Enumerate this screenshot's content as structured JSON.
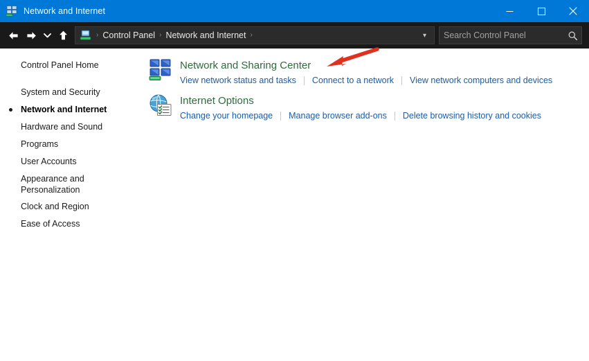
{
  "window": {
    "title": "Network and Internet",
    "title_icon": "network-icon",
    "controls": {
      "minimize": "minimize-button",
      "maximize": "maximize-button",
      "close": "close-button"
    }
  },
  "navbar": {
    "back": "back-arrow-icon",
    "forward": "forward-arrow-icon",
    "recent": "chevron-down-icon",
    "up": "up-arrow-icon",
    "breadcrumb": {
      "icon": "control-panel-network-icon",
      "items": [
        "Control Panel",
        "Network and Internet"
      ],
      "separator": "›",
      "trailing_separator": "›"
    },
    "address_dropdown": "chevron-down-icon"
  },
  "search": {
    "placeholder": "Search Control Panel",
    "value": "",
    "icon": "search-icon"
  },
  "sidebar": {
    "items": [
      {
        "label": "Control Panel Home",
        "selected": false,
        "home": true
      },
      {
        "label": "System and Security",
        "selected": false
      },
      {
        "label": "Network and Internet",
        "selected": true
      },
      {
        "label": "Hardware and Sound",
        "selected": false
      },
      {
        "label": "Programs",
        "selected": false
      },
      {
        "label": "User Accounts",
        "selected": false
      },
      {
        "label": "Appearance and Personalization",
        "selected": false,
        "wrap": true
      },
      {
        "label": "Clock and Region",
        "selected": false
      },
      {
        "label": "Ease of Access",
        "selected": false
      }
    ]
  },
  "main": {
    "categories": [
      {
        "icon": "network-sharing-center-icon",
        "title": "Network and Sharing Center",
        "links": [
          "View network status and tasks",
          "Connect to a network",
          "View network computers and devices"
        ]
      },
      {
        "icon": "internet-options-icon",
        "title": "Internet Options",
        "links": [
          "Change your homepage",
          "Manage browser add-ons",
          "Delete browsing history and cookies"
        ]
      }
    ]
  },
  "annotation": {
    "type": "arrow",
    "color": "#e0301e",
    "points_to": "Network and Sharing Center"
  },
  "colors": {
    "titlebar": "#0078d7",
    "navbar": "#191919",
    "heading_green": "#2d6b3e",
    "link_blue": "#1a5ca8",
    "annotation_red": "#e0301e"
  }
}
